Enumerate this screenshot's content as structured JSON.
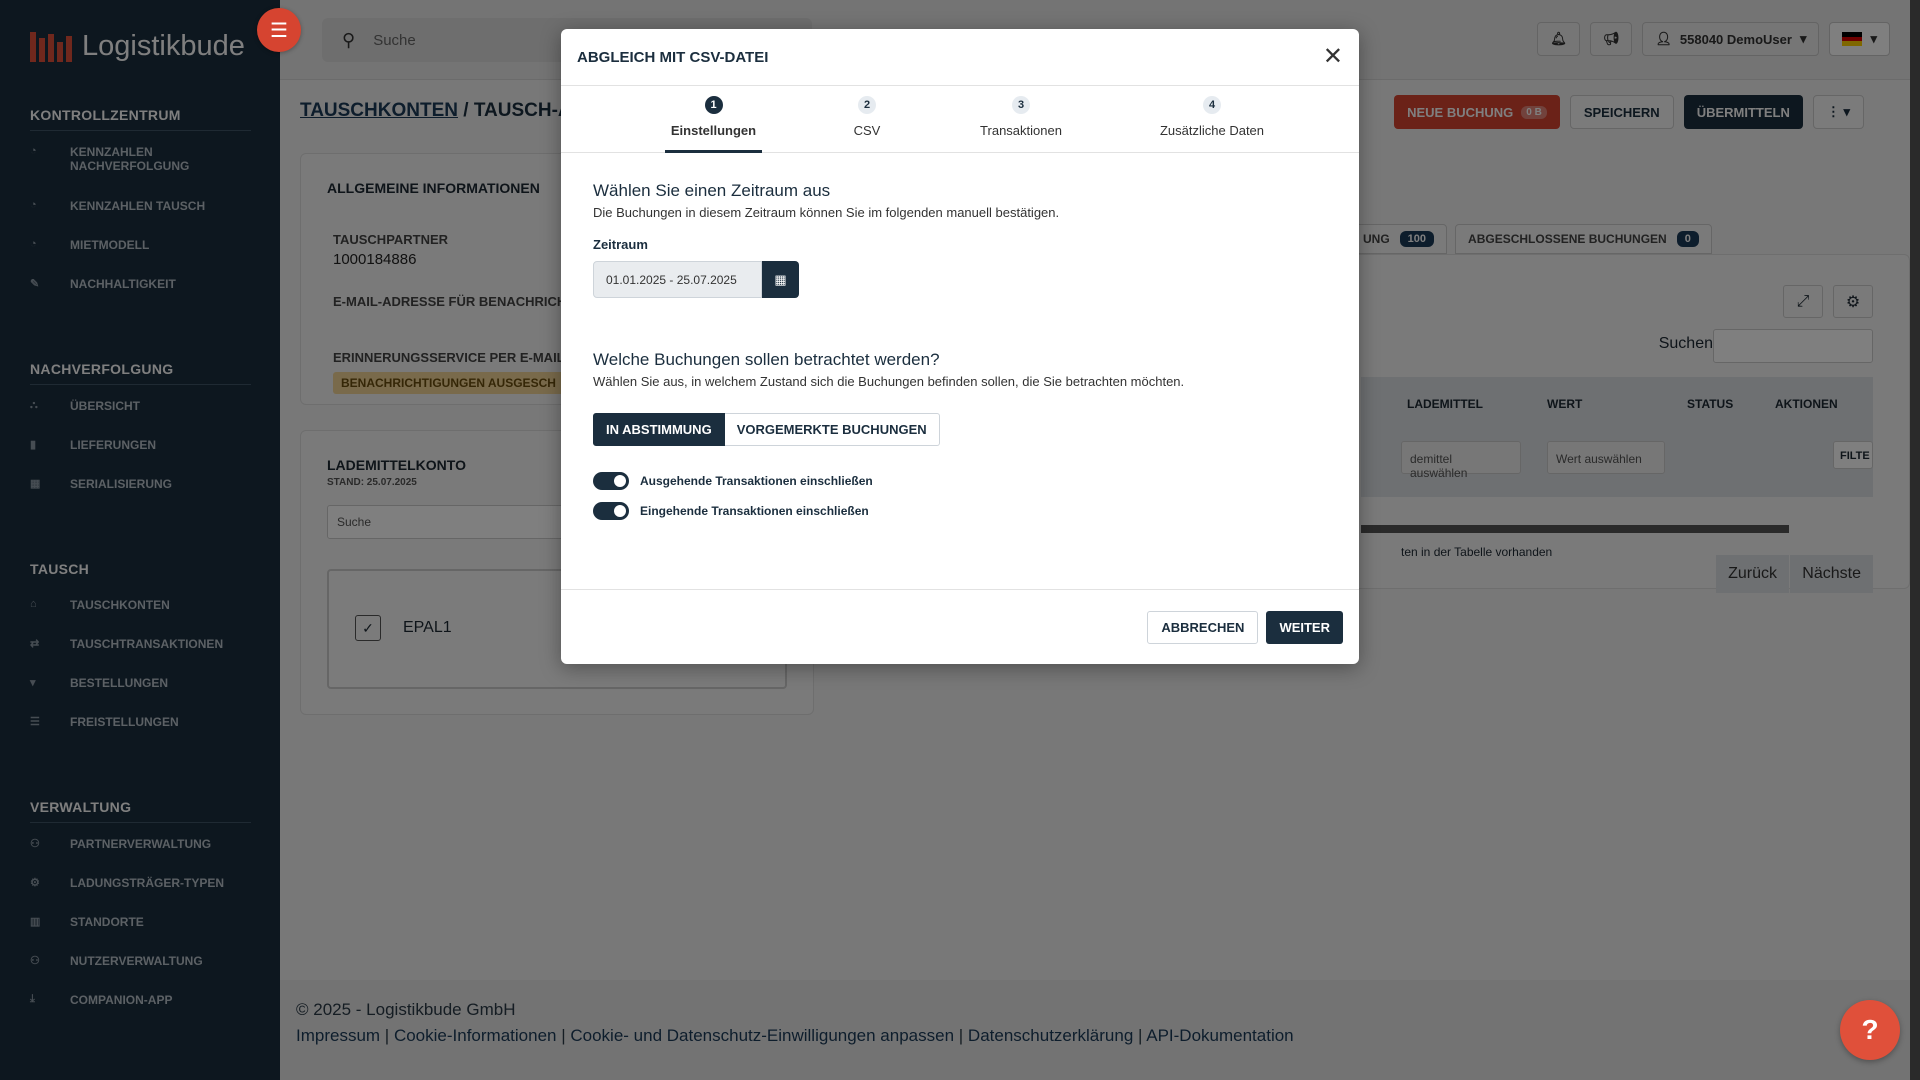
{
  "app": {
    "name": "Logistikbude"
  },
  "sidebar": {
    "sections": [
      {
        "title": "KONTROLLZENTRUM",
        "items": [
          {
            "label": "KENNZAHLEN NACHVERFOLGUNG",
            "icon": "gauge-icon"
          },
          {
            "label": "KENNZAHLEN TAUSCH",
            "icon": "gauge-icon"
          },
          {
            "label": "MIETMODELL",
            "icon": "gauge-icon"
          },
          {
            "label": "NACHHALTIGKEIT",
            "icon": "leaf-icon"
          }
        ]
      },
      {
        "title": "NACHVERFOLGUNG",
        "items": [
          {
            "label": "ÜBERSICHT",
            "icon": "sitemap-icon"
          },
          {
            "label": "LIEFERUNGEN",
            "icon": "file-icon"
          },
          {
            "label": "SERIALISIERUNG",
            "icon": "grid-icon"
          }
        ]
      },
      {
        "title": "TAUSCH",
        "items": [
          {
            "label": "TAUSCHKONTEN",
            "icon": "bank-icon"
          },
          {
            "label": "TAUSCHTRANSAKTIONEN",
            "icon": "exchange-icon"
          },
          {
            "label": "BESTELLUNGEN",
            "icon": "cart-icon"
          },
          {
            "label": "FREISTELLUNGEN",
            "icon": "list-icon"
          }
        ]
      },
      {
        "title": "VERWALTUNG",
        "items": [
          {
            "label": "PARTNERVERWALTUNG",
            "icon": "users-icon"
          },
          {
            "label": "LADUNGSTRÄGER-TYPEN",
            "icon": "pallet-icon"
          },
          {
            "label": "STANDORTE",
            "icon": "map-icon"
          },
          {
            "label": "NUTZERVERWALTUNG",
            "icon": "users-icon"
          },
          {
            "label": "COMPANION-APP",
            "icon": "download-icon"
          }
        ]
      }
    ]
  },
  "topbar": {
    "search_placeholder": "Suche",
    "user_label": "558040 DemoUser",
    "flag_colors": [
      "#000000",
      "#dd0000",
      "#ffce00"
    ]
  },
  "page": {
    "breadcrumb_link": "TAUSCHKONTEN",
    "breadcrumb_rest": " / TAUSCH-A",
    "actions": {
      "neue_buchung": "NEUE BUCHUNG",
      "neue_buchung_badge": "0 B",
      "speichern": "SPEICHERN",
      "uebermitteln": "ÜBERMITTELN"
    }
  },
  "info_card": {
    "title": "ALLGEMEINE INFORMATIONEN",
    "partner_label": "TAUSCHPARTNER",
    "partner_value": "1000184886",
    "email_label": "E-MAIL-ADRESSE FÜR BENACHRICHT",
    "reminder_label": "ERINNERUNGSSERVICE PER E-MAIL",
    "reminder_badge": "BENACHRICHTIGUNGEN AUSGESCH"
  },
  "account_card": {
    "title": "LADEMITTELKONTO",
    "stand": "STAND: 25.07.2025",
    "search_placeholder": "Suche",
    "item_label": "EPAL1"
  },
  "tabs": {
    "tab1_label": "UNG",
    "tab1_count": "100",
    "tab2_label": "ABGESCHLOSSENE BUCHUNGEN",
    "tab2_count": "0"
  },
  "table": {
    "search_label": "Suchen",
    "columns": [
      "LADEMITTEL",
      "WERT",
      "STATUS",
      "AKTIONEN"
    ],
    "filter_lademittel": "demittel auswählen",
    "filter_wert": "Wert auswählen",
    "filter_button": "FILTE",
    "empty_text": "ten in der Tabelle vorhanden",
    "prev": "Zurück",
    "next": "Nächste"
  },
  "footer": {
    "copyright": "© 2025 - Logistikbude GmbH",
    "links": [
      "Impressum",
      "Cookie-Informationen",
      "Cookie- und Datenschutz-Einwilligungen anpassen",
      "Datenschutzerklärung",
      "API-Dokumentation"
    ]
  },
  "modal": {
    "title": "ABGLEICH MIT CSV-DATEI",
    "steps": [
      {
        "num": "1",
        "label": "Einstellungen"
      },
      {
        "num": "2",
        "label": "CSV"
      },
      {
        "num": "3",
        "label": "Transaktionen"
      },
      {
        "num": "4",
        "label": "Zusätzliche Daten"
      }
    ],
    "period_heading": "Wählen Sie einen Zeitraum aus",
    "period_sub": "Die Buchungen in diesem Zeitraum können Sie im folgenden manuell bestätigen.",
    "period_label": "Zeitraum",
    "period_value": "01.01.2025 - 25.07.2025",
    "bookings_heading": "Welche Buchungen sollen betrachtet werden?",
    "bookings_sub": "Wählen Sie aus, in welchem Zustand sich die Buchungen befinden sollen, die Sie betrachten möchten.",
    "seg_on": "IN ABSTIMMUNG",
    "seg_off": "VORGEMERKTE BUCHUNGEN",
    "toggle_out": "Ausgehende Transaktionen einschließen",
    "toggle_in": "Eingehende Transaktionen einschließen",
    "cancel": "ABBRECHEN",
    "next": "WEITER"
  }
}
